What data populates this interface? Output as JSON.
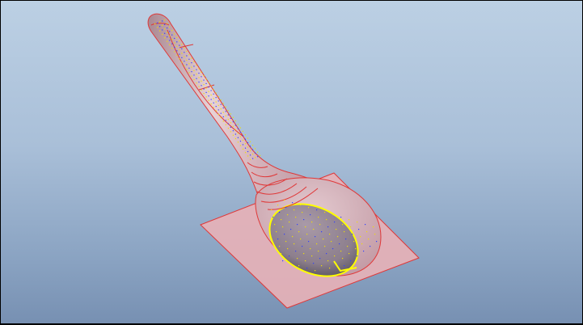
{
  "viewport": {
    "background_top": "#bcd0e4",
    "background_bottom": "#7790b2"
  },
  "model": {
    "name": "spoon",
    "colors": {
      "surface": "#d8b4bc",
      "surface_shade": "#c39aa5",
      "plane": "#e8b1b7",
      "edge": "#e03838",
      "mesh_point_yellow": "#f0e000",
      "mesh_point_blue": "#3040ff",
      "bowl_outline": "#ffff00"
    }
  }
}
